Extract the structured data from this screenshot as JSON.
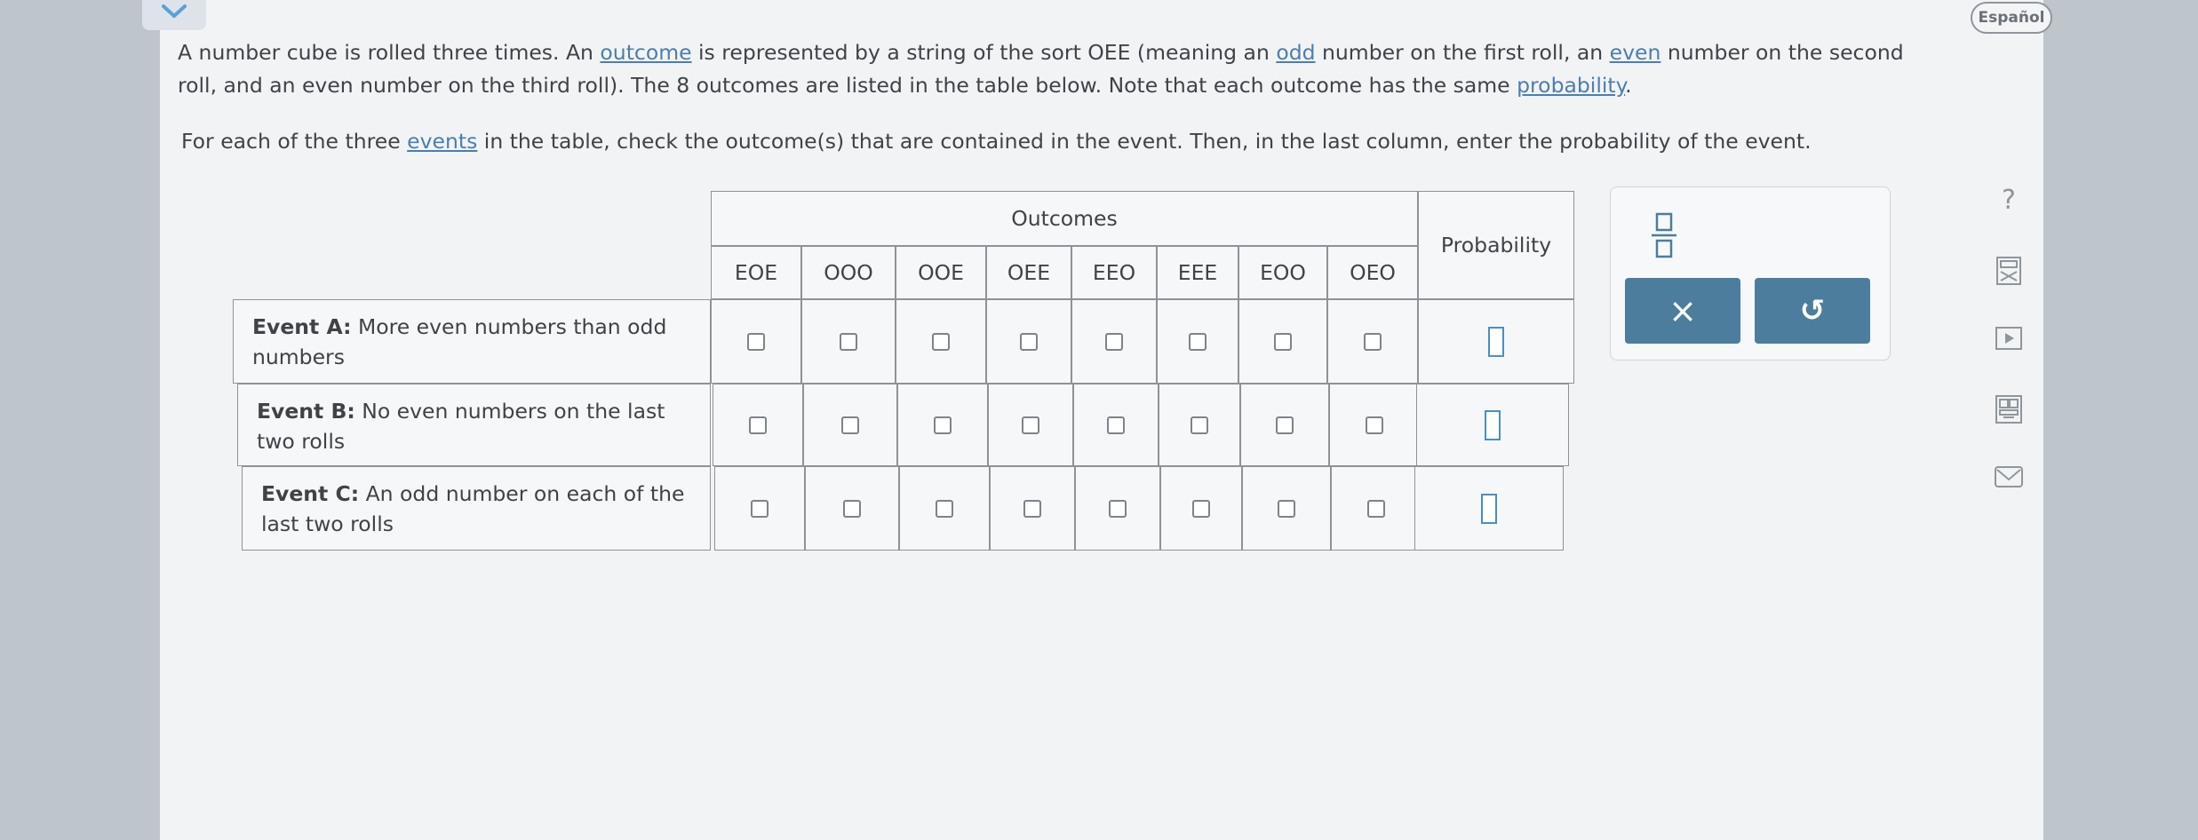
{
  "language_button": "Español",
  "intro": {
    "p1_a": "A number cube is rolled three times. An ",
    "p1_outcome": "outcome",
    "p1_b": " is represented by a string of the sort OEE (meaning an ",
    "p1_odd": "odd",
    "p1_c": " number on the first roll, an ",
    "p1_even": "even",
    "p1_d": " number on the second roll, and an even number on the third roll). The 8 outcomes are listed in the table below. Note that each outcome has the same ",
    "p1_probability": "probability",
    "p1_e": ".",
    "p2_a": "For each of the three ",
    "p2_events": "events",
    "p2_b": " in the table, check the outcome(s) that are contained in the event. Then, in the last column, enter the probability of the event."
  },
  "table": {
    "outcomes_header": "Outcomes",
    "probability_header": "Probability",
    "outcomes": [
      "EOE",
      "OOO",
      "OOE",
      "OEE",
      "EEO",
      "EEE",
      "EOO",
      "OEO"
    ],
    "events": [
      {
        "name": "Event A:",
        "desc_line1": " More even numbers than odd",
        "desc_line2": "numbers"
      },
      {
        "name": "Event B:",
        "desc_line1": " No even numbers on the last",
        "desc_line2": "two rolls"
      },
      {
        "name": "Event C:",
        "desc_line1": " An odd number on each of the",
        "desc_line2": "last two rolls"
      }
    ]
  },
  "tools": {
    "clear_symbol": "×",
    "undo_symbol": "↺"
  },
  "colors": {
    "link": "#4a7fb0",
    "button": "#4d7d9c",
    "input_border": "#4a8ec2"
  }
}
